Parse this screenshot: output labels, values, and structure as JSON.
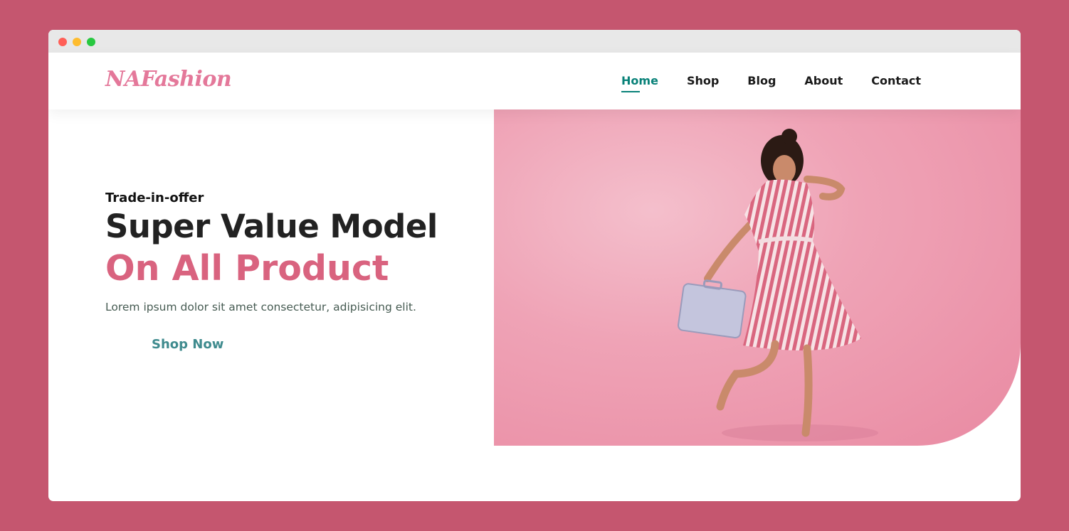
{
  "window": {
    "controls": [
      "close",
      "minimize",
      "maximize"
    ]
  },
  "navbar": {
    "logo": "NAFashion",
    "links": [
      {
        "label": "Home",
        "active": true
      },
      {
        "label": "Shop",
        "active": false
      },
      {
        "label": "Blog",
        "active": false
      },
      {
        "label": "About",
        "active": false
      },
      {
        "label": "Contact",
        "active": false
      }
    ]
  },
  "hero": {
    "offer": "Trade-in-offer",
    "headline": "Super Value Model",
    "subheadline": "On All Product",
    "description": "Lorem ipsum dolor sit amet consectetur, adipisicing elit.",
    "button_label": "Shop Now"
  },
  "colors": {
    "page_background": "#c5566f",
    "logo": "#e4789a",
    "accent_pink": "#d9637f",
    "active_link": "#088178",
    "button_text": "#3f8b8e",
    "hero_background": "#efa3b6"
  },
  "icons": {
    "window_close": "red-dot-icon",
    "window_minimize": "yellow-dot-icon",
    "window_maximize": "green-dot-icon"
  }
}
